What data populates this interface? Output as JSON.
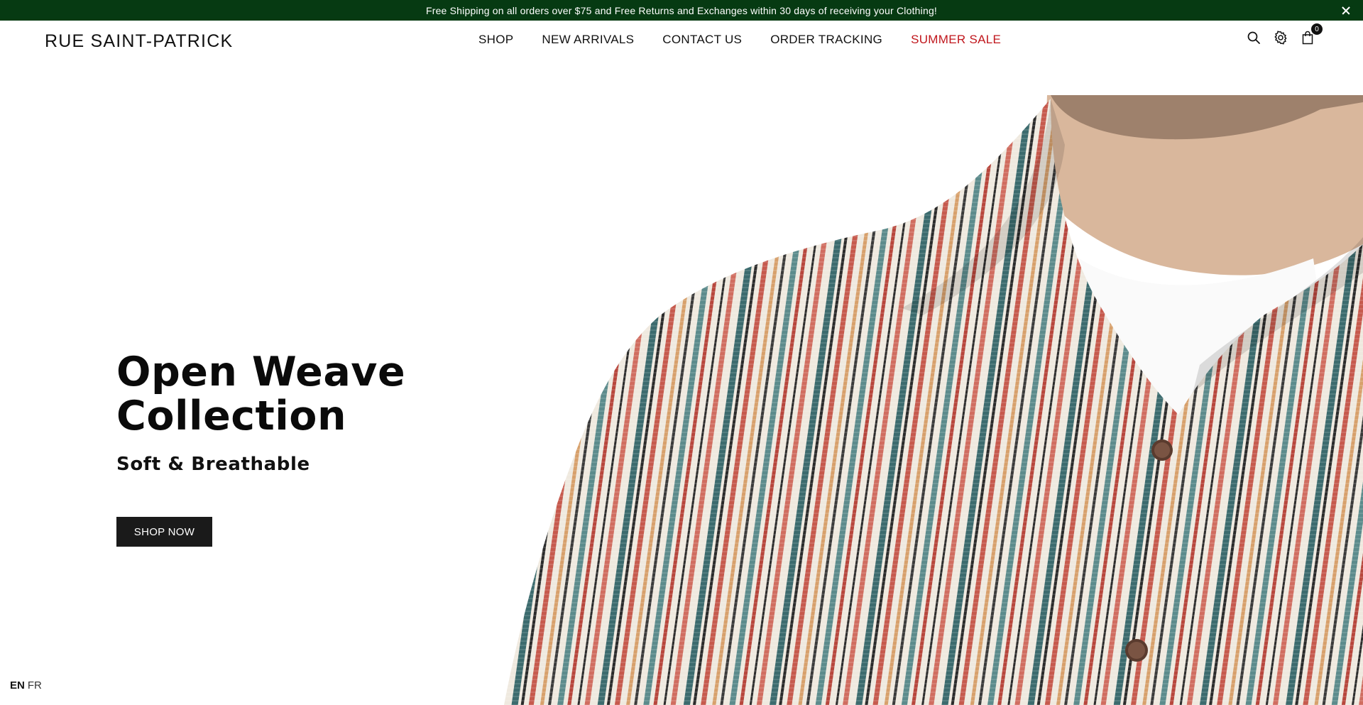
{
  "announcement": {
    "text": "Free Shipping on all orders over $75 and Free Returns and Exchanges within 30 days of receiving your Clothing!",
    "close_icon": "close-icon"
  },
  "header": {
    "logo": "RUE SAINT-PATRICK",
    "nav": [
      {
        "label": "SHOP"
      },
      {
        "label": "NEW ARRIVALS"
      },
      {
        "label": "CONTACT US"
      },
      {
        "label": "ORDER TRACKING"
      },
      {
        "label": "SUMMER SALE",
        "color": "#c0161c"
      }
    ],
    "icons": [
      "search-icon",
      "gear-icon",
      "bag-icon"
    ],
    "cart_count": "0"
  },
  "hero": {
    "title_line1": "Open Weave",
    "title_line2": "Collection",
    "subtitle": "Soft & Breathable",
    "cta": "SHOP NOW"
  },
  "language": {
    "active": "EN",
    "other": "FR"
  },
  "colors": {
    "announcement_bg": "#063a12",
    "sale": "#c0161c",
    "button_bg": "#1a1a1a"
  }
}
